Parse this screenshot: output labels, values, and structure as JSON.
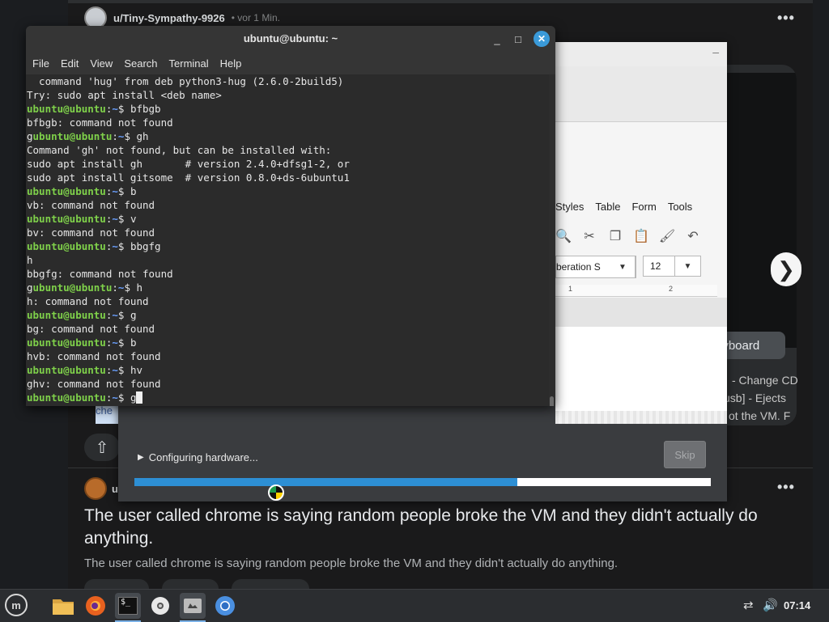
{
  "background_page": {
    "post1": {
      "username": "u/Tiny-Sympathy-9926",
      "timeago": "• vor 1 Min."
    },
    "keyboard_button": "eyboard",
    "side_texts": [
      "- Change CD",
      "usb] - Ejects",
      "ot the VM. F"
    ],
    "tag_text": "che",
    "post2": {
      "username": "u",
      "title": "The user called chrome is saying random people broke the VM and they didn't actually do anything.",
      "body": "The user called chrome is saying random people broke the VM and they didn't actually do anything."
    },
    "more_icon": "•••",
    "upvote_icon": "⇧",
    "nav_arrow": "❯"
  },
  "installer": {
    "menu_items": [
      "Styles",
      "Table",
      "Form",
      "Tools"
    ],
    "font_name": "beration S",
    "font_size": "12",
    "ruler_marks": [
      "1",
      "2"
    ],
    "status_text": "Configuring hardware...",
    "skip_label": "Skip",
    "progress": 0.665
  },
  "terminal": {
    "title": "ubuntu@ubuntu: ~",
    "menu": [
      "File",
      "Edit",
      "View",
      "Search",
      "Terminal",
      "Help"
    ],
    "prompt_user": "ubuntu@ubuntu",
    "prompt_path": "~",
    "lines": [
      {
        "type": "out",
        "text": "  command 'hug' from deb python3-hug (2.6.0-2build5)"
      },
      {
        "type": "out",
        "text": "Try: sudo apt install <deb name>"
      },
      {
        "type": "prompt",
        "pre": "",
        "cmd": "bfbgb"
      },
      {
        "type": "out",
        "text": "bfbgb: command not found"
      },
      {
        "type": "prompt",
        "pre": "g",
        "cmd": "gh"
      },
      {
        "type": "out",
        "text": "Command 'gh' not found, but can be installed with:"
      },
      {
        "type": "out",
        "text": "sudo apt install gh       # version 2.4.0+dfsg1-2, or"
      },
      {
        "type": "out",
        "text": "sudo apt install gitsome  # version 0.8.0+ds-6ubuntu1"
      },
      {
        "type": "prompt",
        "pre": "",
        "cmd": "b"
      },
      {
        "type": "out",
        "text": "vb: command not found"
      },
      {
        "type": "prompt",
        "pre": "",
        "cmd": "v"
      },
      {
        "type": "out",
        "text": "bv: command not found"
      },
      {
        "type": "prompt",
        "pre": "",
        "cmd": "bbgfg"
      },
      {
        "type": "out",
        "text": "h"
      },
      {
        "type": "out",
        "text": "bbgfg: command not found"
      },
      {
        "type": "prompt",
        "pre": "g",
        "cmd": "h"
      },
      {
        "type": "out",
        "text": "h: command not found"
      },
      {
        "type": "prompt",
        "pre": "",
        "cmd": "g"
      },
      {
        "type": "out",
        "text": "bg: command not found"
      },
      {
        "type": "prompt",
        "pre": "",
        "cmd": "b"
      },
      {
        "type": "out",
        "text": "hvb: command not found"
      },
      {
        "type": "prompt",
        "pre": "",
        "cmd": "hv"
      },
      {
        "type": "out",
        "text": "ghv: command not found"
      },
      {
        "type": "prompt",
        "pre": "",
        "cmd": "g",
        "cursor": true
      }
    ]
  },
  "taskbar": {
    "apps": [
      {
        "name": "files-app",
        "icon": "folder-icon"
      },
      {
        "name": "firefox-app",
        "icon": "firefox-icon"
      },
      {
        "name": "terminal-app",
        "icon": "terminal-icon",
        "label": "$_"
      },
      {
        "name": "disc-app",
        "icon": "disc-icon"
      },
      {
        "name": "installer-app",
        "icon": "installer-icon"
      },
      {
        "name": "chromium-app",
        "icon": "chromium-icon"
      }
    ],
    "clock": "07:14"
  }
}
